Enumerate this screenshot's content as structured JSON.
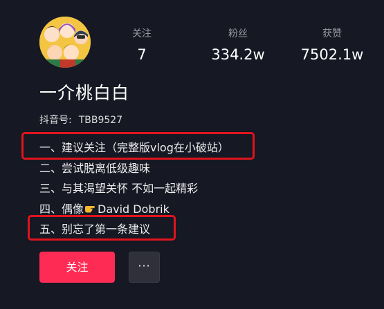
{
  "profile": {
    "avatar_icon": "cartoon-group-avatar",
    "nickname": "一介桃白白",
    "douyin_id_label": "抖音号:",
    "douyin_id": "TBB9527"
  },
  "stats": {
    "following_label": "关注",
    "following_value": "7",
    "followers_label": "粉丝",
    "followers_value": "334.2w",
    "likes_label": "获赞",
    "likes_value": "7502.1w"
  },
  "bio": {
    "line1": "一、建议关注（完整版vlog在小破站）",
    "line2": "二、尝试脱离低级趣味",
    "line3": "三、与其渴望关怀 不如一起精彩",
    "line4_prefix": "四、偶像",
    "line4_icon": "pointing-hand-emoji",
    "line4_suffix": "David Dobrik",
    "line5": "五、别忘了第一条建议"
  },
  "actions": {
    "follow_label": "关注",
    "more_label": "···"
  },
  "colors": {
    "background": "#161823",
    "follow_button": "#fe2c55",
    "highlight_box": "#e0141c",
    "more_button": "#2f303a"
  }
}
